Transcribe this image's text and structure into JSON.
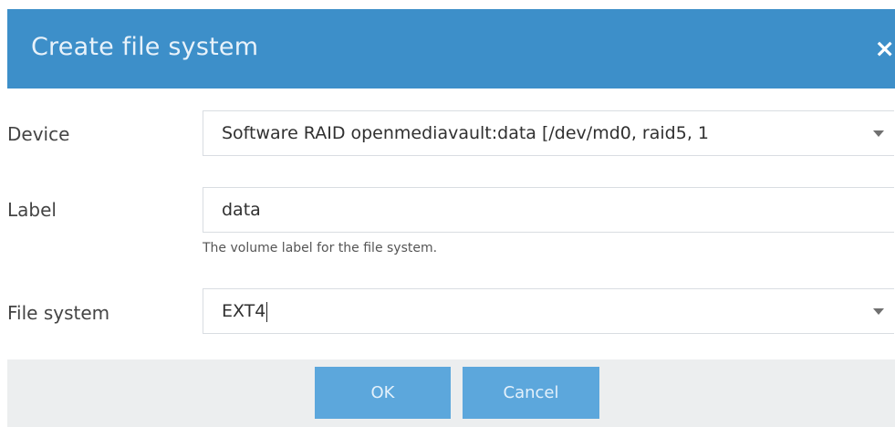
{
  "dialog": {
    "title": "Create file system",
    "close_icon": "×"
  },
  "form": {
    "device": {
      "label": "Device",
      "value": "Software RAID openmediavault:data [/dev/md0, raid5, 1"
    },
    "volume_label": {
      "label": "Label",
      "value": "data",
      "hint": "The volume label for the file system."
    },
    "file_system": {
      "label": "File system",
      "value": "EXT4"
    }
  },
  "buttons": {
    "ok": "OK",
    "cancel": "Cancel"
  },
  "icons": {
    "close": "close-icon",
    "dropdown": "chevron-down-icon"
  },
  "colors": {
    "titlebar": "#3d8fc9",
    "button": "#5ca7dc",
    "footer": "#eceeef"
  }
}
